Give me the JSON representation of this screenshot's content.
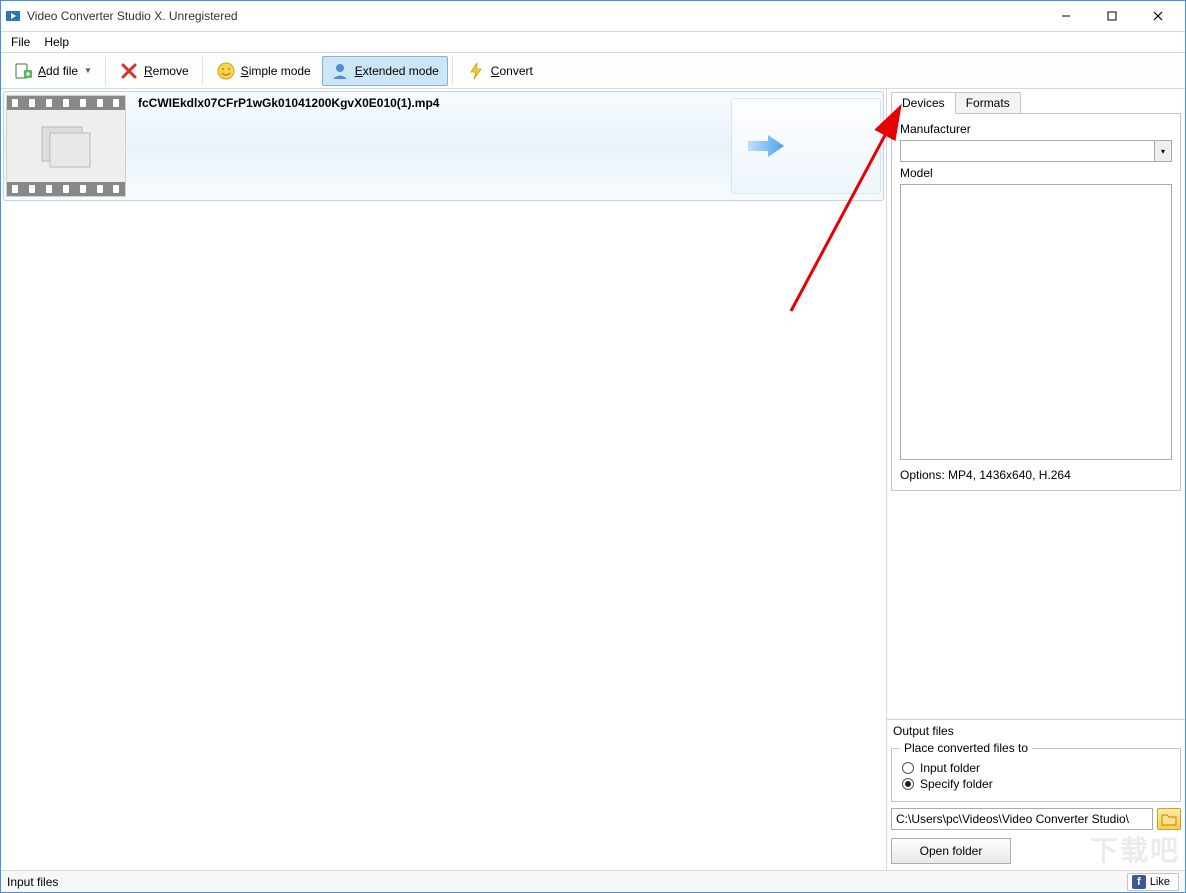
{
  "window": {
    "title": "Video Converter Studio X. Unregistered"
  },
  "menu": {
    "file": "File",
    "help": "Help"
  },
  "toolbar": {
    "add_file": "Add file",
    "remove": "Remove",
    "simple_mode": "Simple mode",
    "extended_mode": "Extended mode",
    "convert": "Convert",
    "add_file_mn": "A",
    "remove_mn": "R",
    "simple_mn": "S",
    "extended_mn": "E",
    "convert_mn": "C"
  },
  "files": [
    {
      "name": "fcCWIEkdlx07CFrP1wGk01041200KgvX0E010(1).mp4"
    }
  ],
  "tabs": {
    "devices": "Devices",
    "formats": "Formats"
  },
  "device_panel": {
    "manufacturer_label": "Manufacturer",
    "manufacturer_value": "",
    "model_label": "Model",
    "options_text": "Options: MP4, 1436x640, H.264"
  },
  "output": {
    "header": "Output files",
    "legend": "Place converted files to",
    "radio_input_folder": "Input folder",
    "radio_specify_folder": "Specify folder",
    "path": "C:\\Users\\pc\\Videos\\Video Converter Studio\\",
    "open_folder": "Open folder"
  },
  "status": {
    "left": "Input files",
    "like": "Like"
  },
  "watermark": "下载吧"
}
